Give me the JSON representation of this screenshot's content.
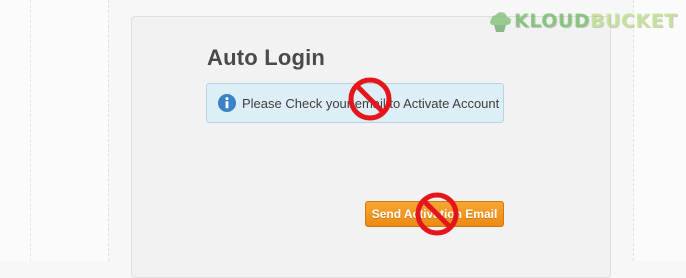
{
  "page": {
    "title": "Auto Login"
  },
  "alert": {
    "icon": "info-icon",
    "message": "Please Check your email to Activate Account"
  },
  "actions": {
    "send_activation_label": "Send Activation Email"
  },
  "overlays": {
    "icon": "no-symbol-icon"
  },
  "watermark": {
    "text_part1": "KLOUD",
    "text_part2": "BUCKET",
    "icon": "cloud-bucket-logo-icon"
  },
  "colors": {
    "button_bg": "#f39b21",
    "alert_bg": "#deeef7",
    "alert_border": "#b6d4e6",
    "info_icon": "#3b82c6",
    "no_symbol": "#e4161b"
  }
}
